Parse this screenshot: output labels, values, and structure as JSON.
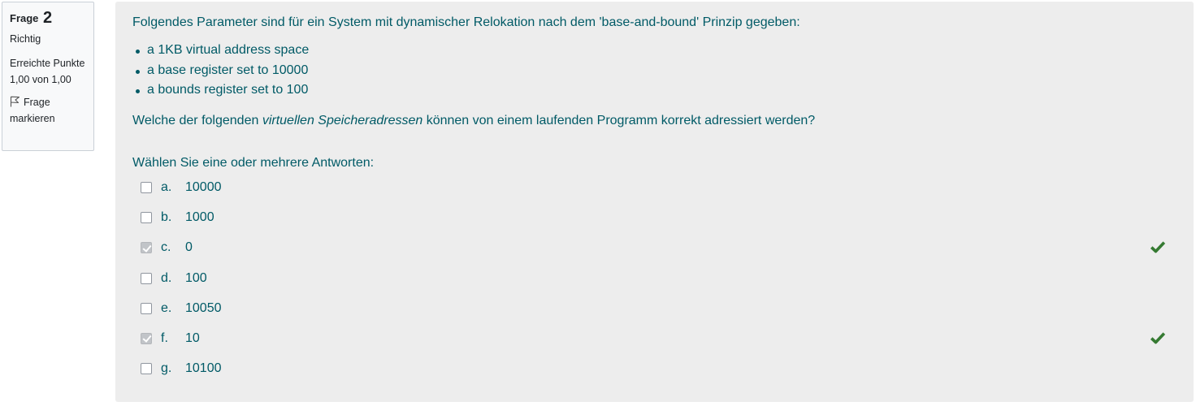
{
  "info": {
    "question_word": "Frage",
    "question_number": "2",
    "state": "Richtig",
    "grade": "Erreichte Punkte 1,00 von 1,00",
    "flag_label": "Frage markieren"
  },
  "question": {
    "intro": "Folgendes Parameter sind für ein System mit dynamischer Relokation nach dem 'base-and-bound' Prinzip gegeben:",
    "bullets": [
      "a 1KB virtual address space",
      "a base register set to 10000",
      "a bounds register set to 100"
    ],
    "text_before": "Welche der folgenden ",
    "text_em": "virtuellen Speicheradressen",
    "text_after": " können von einem laufenden Programm korrekt adressiert werden?",
    "prompt": "Wählen Sie eine oder mehrere Antworten:"
  },
  "answers": [
    {
      "letter": "a.",
      "value": "10000",
      "checked": false,
      "correct": false
    },
    {
      "letter": "b.",
      "value": "1000",
      "checked": false,
      "correct": false
    },
    {
      "letter": "c.",
      "value": "0",
      "checked": true,
      "correct": true
    },
    {
      "letter": "d.",
      "value": "100",
      "checked": false,
      "correct": false
    },
    {
      "letter": "e.",
      "value": "10050",
      "checked": false,
      "correct": false
    },
    {
      "letter": "f.",
      "value": "10",
      "checked": true,
      "correct": true
    },
    {
      "letter": "g.",
      "value": "10100",
      "checked": false,
      "correct": false
    }
  ],
  "icons": {
    "flag": "flag-outline-icon",
    "correct": "checkmark-icon"
  },
  "colors": {
    "text": "#005a66",
    "correct": "#357a32",
    "panel": "#ededed",
    "info_bg": "#f8f9fa"
  }
}
